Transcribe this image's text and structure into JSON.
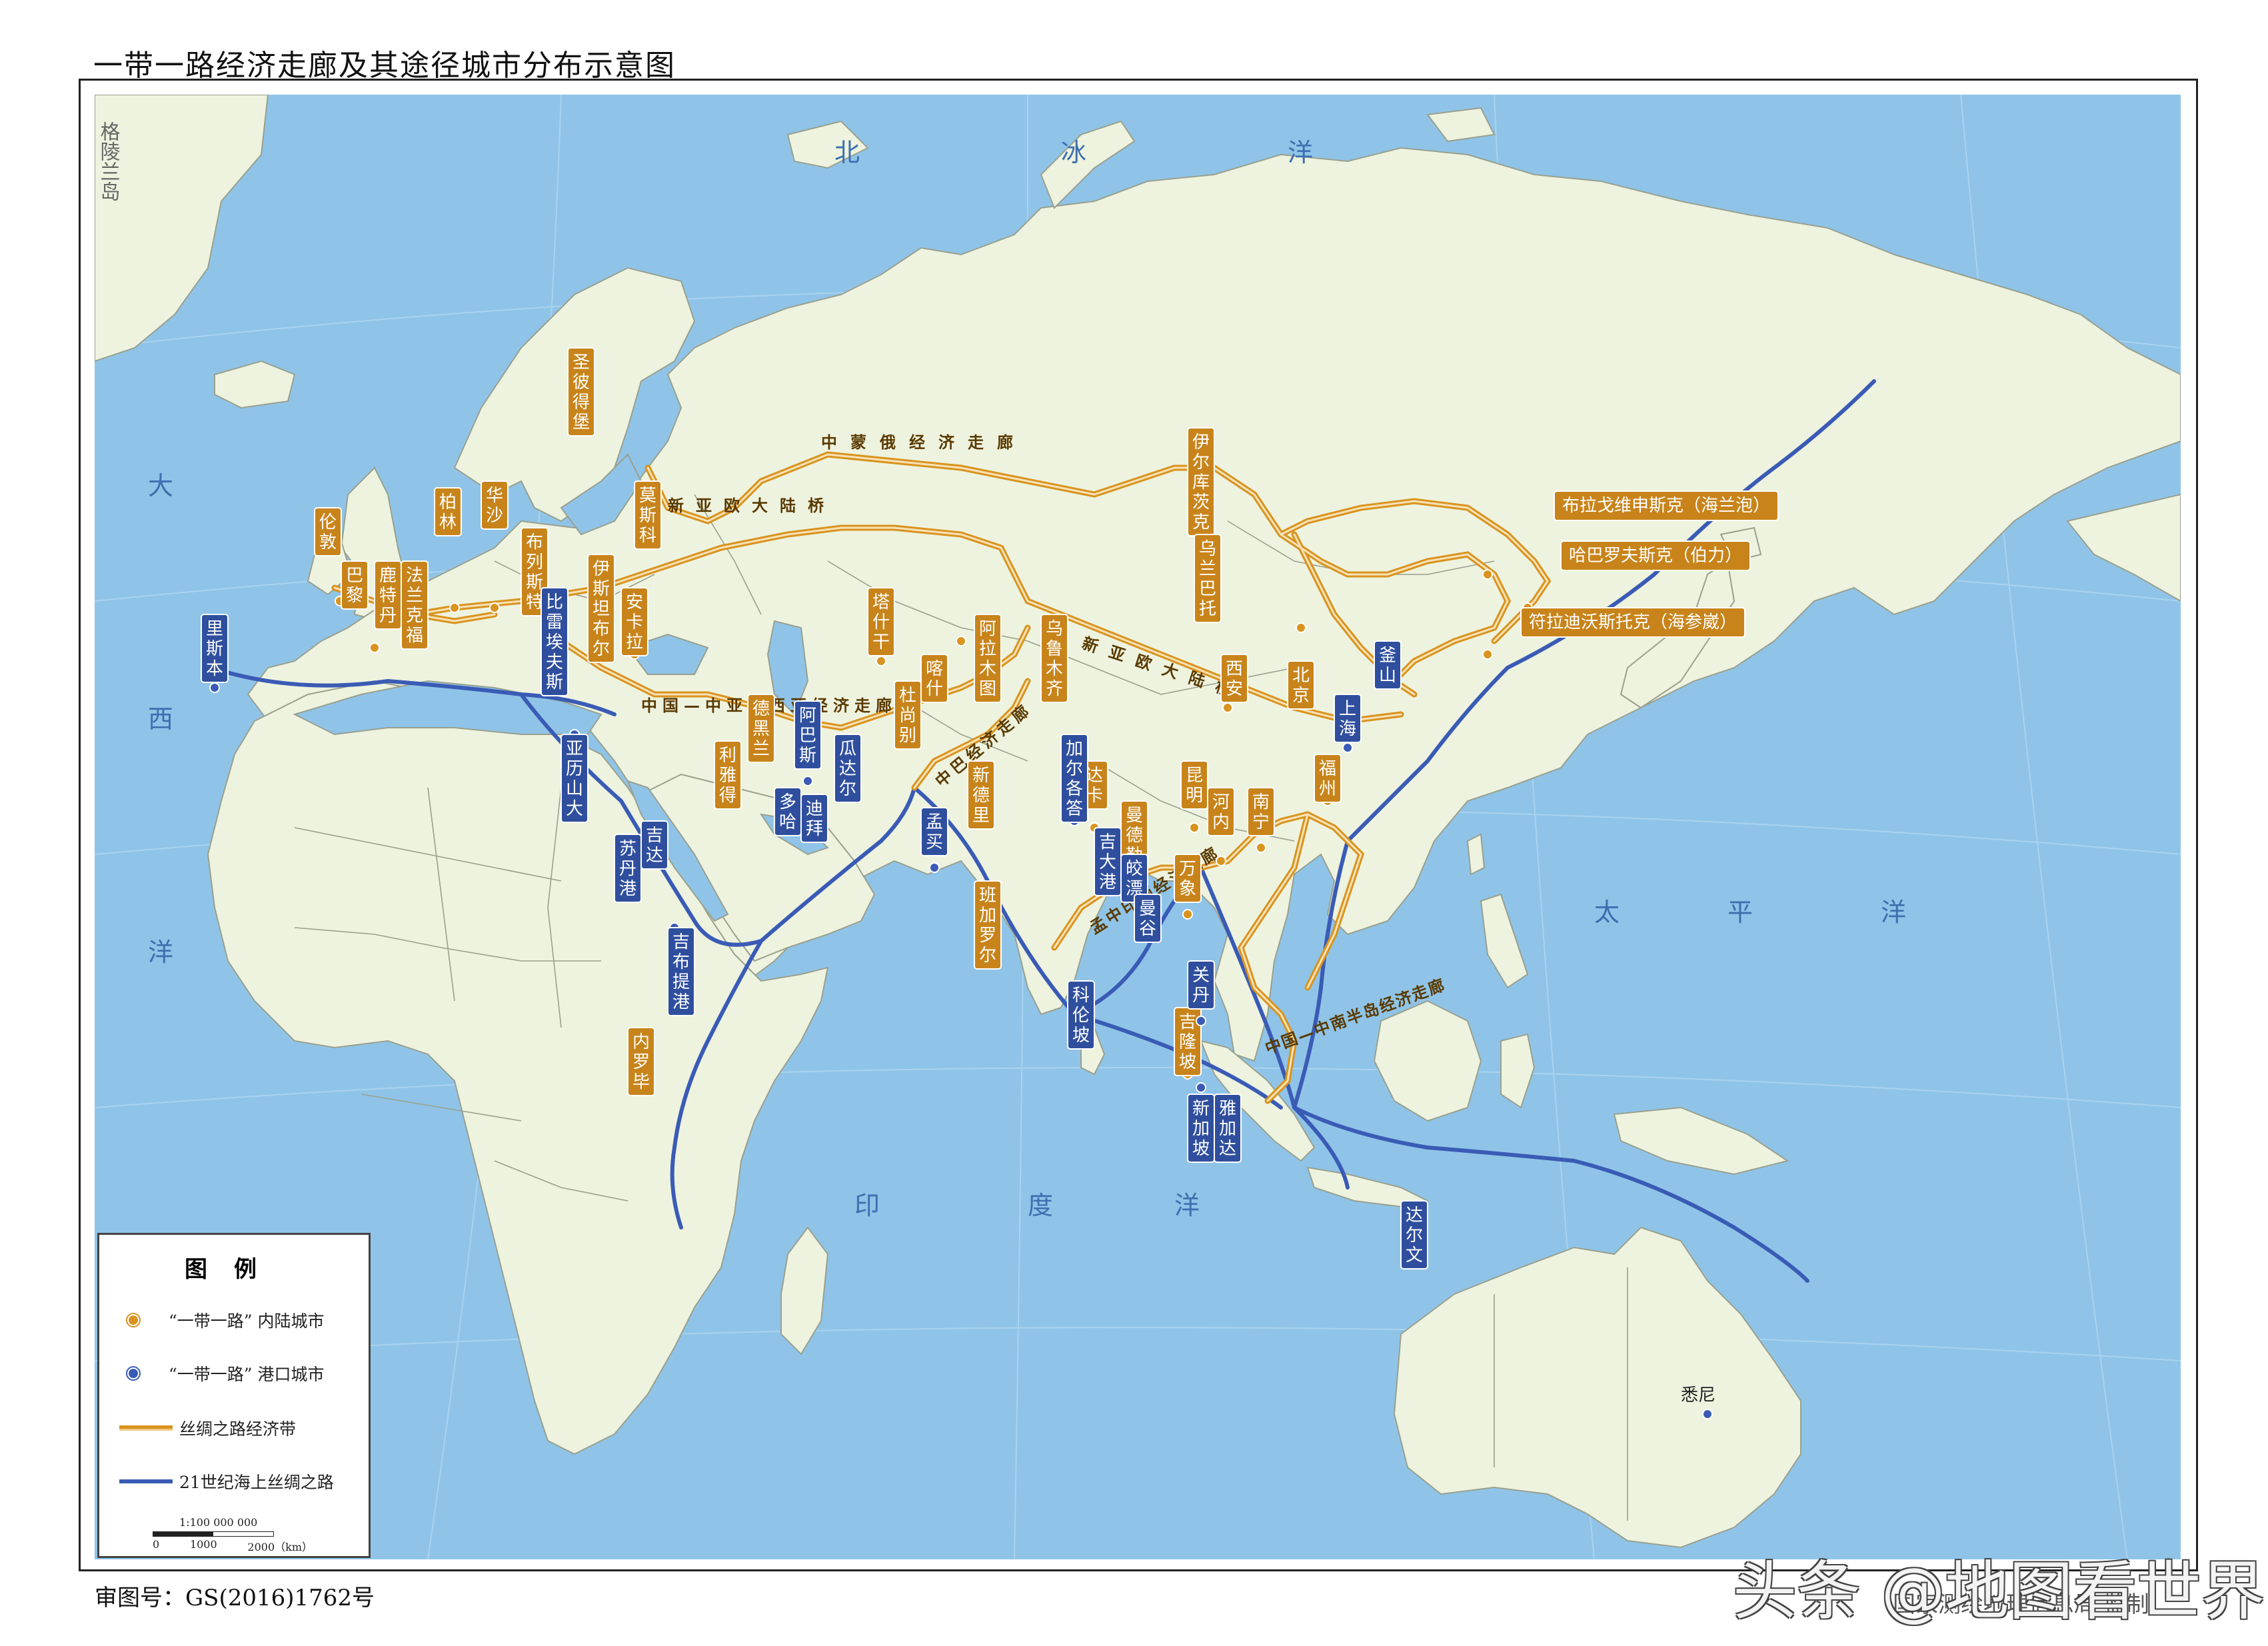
{
  "title": "一带一路经济走廊及其途径城市分布示意图",
  "approval_number": "审图号：GS(2016)1762号",
  "watermark": "头条 @地图看世界",
  "publisher": "国家测绘地理信息局 监制",
  "colors": {
    "ocean": "#8fc4e8",
    "land": "#eef3df",
    "border": "#8a8f80",
    "inland_route": "#d9931e",
    "inland_label_bg": "#c8841a",
    "maritime_route": "#3a5bb5",
    "port_label_bg": "#2f4f9e"
  },
  "legend": {
    "title": "图例",
    "inland_city": "“一带一路” 内陆城市",
    "port_city": "“一带一路” 港口城市",
    "silk_belt": "丝绸之路经济带",
    "maritime_road": "21世纪海上丝绸之路",
    "scale_ratio": "1:100 000 000",
    "scale_ticks": [
      "0",
      "1000",
      "2000（km）"
    ]
  },
  "sea_labels": {
    "greenland": "格陵兰岛",
    "arctic_1": "北",
    "arctic_2": "冰",
    "arctic_3": "洋",
    "atlantic_1": "大",
    "atlantic_2": "西",
    "atlantic_3": "洋",
    "pacific_1": "太",
    "pacific_2": "平",
    "pacific_3": "洋",
    "indian_1": "印",
    "indian_2": "度",
    "indian_3": "洋"
  },
  "corridor_labels": {
    "cmr": "中蒙俄经济走廊",
    "nelb_north": "新亚欧大陆桥",
    "nelb_south": "新亚欧大陆桥",
    "ccawa": "中国—中亚—西亚经济走廊",
    "cpec": "中巴经济走廊",
    "bcim": "孟中印缅经济走廊",
    "cicp": "中国—中南半岛经济走廊"
  },
  "inland_cities": {
    "london": "伦敦",
    "paris": "巴黎",
    "rotterdam": "鹿特丹",
    "frankfurt": "法兰克福",
    "berlin": "柏林",
    "warsaw": "华沙",
    "brest": "布列斯特",
    "stpetersburg": "圣彼得堡",
    "moscow": "莫斯科",
    "ankara": "安卡拉",
    "istanbul": "伊斯坦布尔",
    "tehran": "德黑兰",
    "riyadh": "利雅得",
    "tashkent": "塔什干",
    "dushanbe": "杜尚别",
    "kashgar": "喀什",
    "almaty": "阿拉木图",
    "urumqi": "乌鲁木齐",
    "irkutsk": "伊尔库茨克",
    "ulaanbaatar": "乌兰巴托",
    "ulanude": "布拉戈维申斯克（海兰泡）",
    "khabarovsk": "哈巴罗夫斯克（伯力）",
    "vladivostok": "符拉迪沃斯托克（海参崴）",
    "xian": "西安",
    "beijing": "北京",
    "newdelhi": "新德里",
    "dhaka": "达卡",
    "kunming": "昆明",
    "mandalay": "曼德勒",
    "hanoi": "河内",
    "nanning": "南宁",
    "vientiane": "万象",
    "bangalore": "班加罗尔",
    "kualalumpur": "吉隆坡",
    "nairobi": "内罗毕",
    "fuzhou": "福州"
  },
  "port_cities": {
    "lisbon": "里斯本",
    "piraeus": "比雷埃夫斯",
    "alexandria": "亚历山大",
    "jeddah": "吉达",
    "portsudan": "苏丹港",
    "djibouti": "吉布提港",
    "doha": "多哈",
    "dubai": "迪拜",
    "abbas": "阿巴斯",
    "gwadar": "瓜达尔",
    "mumbai": "孟买",
    "colombo": "科伦坡",
    "kolkata": "加尔各答",
    "chittagong": "吉大港",
    "sittwe": "皎漂",
    "bangkok": "曼谷",
    "kuantan": "关丹",
    "singapore": "新加坡",
    "jakarta": "雅加达",
    "darwin": "达尔文",
    "sydney": "悉尼",
    "shanghai": "上海",
    "busan": "釜山"
  }
}
